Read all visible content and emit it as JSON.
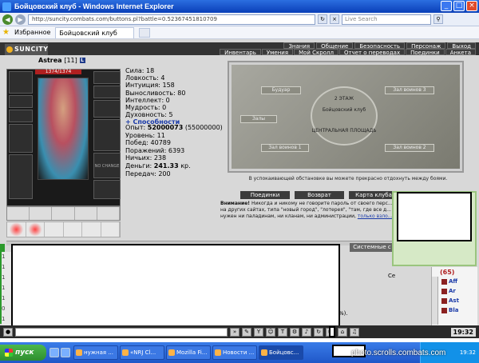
{
  "window": {
    "title": "Бойцовский клуб - Windows Internet Explorer"
  },
  "browser": {
    "url": "http://suncity.combats.com/buttons.pl?battle=0.52367451810709",
    "search_placeholder": "Live Search",
    "favorites_label": "Избранное",
    "tab_title": "Бойцовский клуб"
  },
  "game": {
    "logo": "SUNCITY",
    "menu_top": [
      "Знания",
      "Общение",
      "Безопасность",
      "Персонаж",
      "Выход"
    ],
    "menu_bottom": [
      "Инвентарь",
      "Умения",
      "Мой Скролл",
      "Отчет о переводах",
      "Поединки",
      "Анкета"
    ],
    "character": {
      "name": "Astrea",
      "level": "[11]",
      "flag": "L",
      "hp": "1374/1374",
      "nochange": "NO CHANGE"
    },
    "stats": [
      "Сила: 18",
      "Ловкость: 4",
      "Интуиция: 158",
      "Выносливость: 80",
      "Интеллект: 0",
      "Мудрость: 0",
      "Духовность: 5"
    ],
    "abilities_link": "+ Способности",
    "progress": {
      "exp_label": "Опыт:",
      "exp_value": "52000073",
      "exp_next": "(55000000)",
      "level": "Уровень: 11",
      "wins": "Побед: 40789",
      "losses": "Поражений: 6393",
      "draws": "Ничьих: 238",
      "money_label": "Деньги:",
      "money_value": "241.33",
      "money_unit": "кр.",
      "transfers": "Передач: 200"
    },
    "map": {
      "plaques": [
        "Будуар",
        "Зал воинов 3",
        "Залы",
        "Зал воинов 1",
        "Зал воинов 2"
      ],
      "center_top": "2 ЭТАЖ",
      "center_mid": "Бойцовский клуб",
      "center_bottom": "ЦЕНТРАЛЬНАЯ ПЛОЩАДЬ",
      "note": "В успокаивающей обстановке вы можете прекрасно отдохнуть между боями."
    },
    "map_buttons": [
      "Поединки",
      "Возврат",
      "Карта клуба"
    ],
    "warning": {
      "bold": "Внимание!",
      "text": " Никогда и никому не говорите пароль от своего перс... на других сайтах, типа \"новый город\", \"лотерея\", \"там, где все д... нужен ни паладинам, ни кланам, ни администрации, ",
      "link": "только взло..."
    },
    "chat": {
      "system_tab": "Системные с",
      "cut_label": "Се",
      "line_prefixes": [
        "1",
        "1",
        "1",
        "1",
        "1",
        "0",
        "1"
      ],
      "percent": "%).",
      "online_count": "(65)",
      "online": [
        "Aff",
        "Ar",
        "Ast",
        "Bla"
      ]
    },
    "clock": "19:32"
  },
  "taskbar": {
    "start_label": "пуск",
    "tasks": [
      "нужная ...",
      "«NRJ Cl...",
      "Mozilla Fi...",
      "Новости ...",
      "Бойцовс..."
    ],
    "tray_time": "19:32",
    "watermark": "photo.scrolls.combats.com"
  }
}
